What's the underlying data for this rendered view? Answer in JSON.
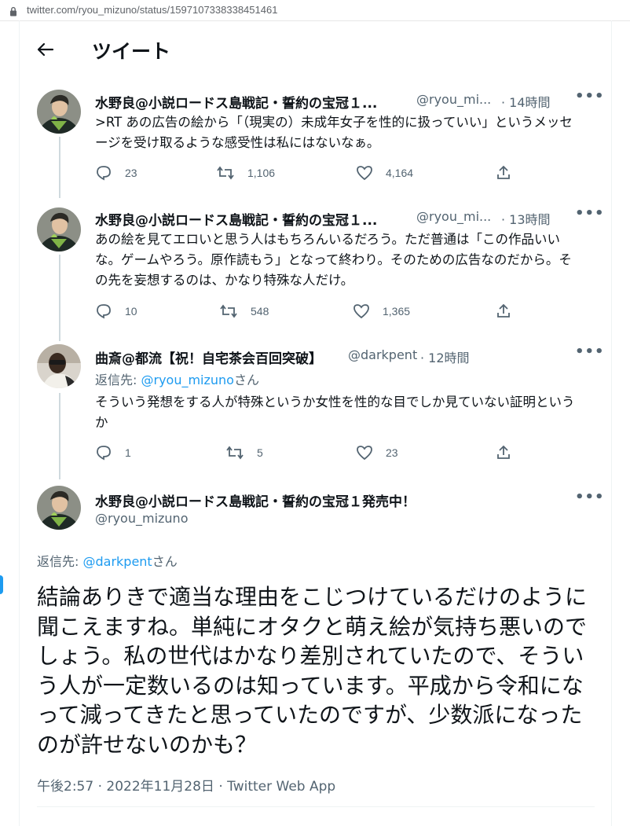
{
  "browser": {
    "url": "twitter.com/ryou_mizuno/status/1597107338338451461"
  },
  "header": {
    "title": "ツイート"
  },
  "thread": [
    {
      "name": "水野良@小説ロードス島戦記・誓約の宝冠１...",
      "handle": "@ryou_mi...",
      "time": "· 14時間",
      "text": ">RT あの広告の絵から「（現実の）未成年女子を性的に扱っていい」というメッセージを受け取るような感受性は私にはないなぁ。",
      "replies": "23",
      "retweets": "1,106",
      "likes": "4,164"
    },
    {
      "name": "水野良@小説ロードス島戦記・誓約の宝冠１...",
      "handle": "@ryou_mi...",
      "time": "· 13時間",
      "text": "あの絵を見てエロいと思う人はもちろんいるだろう。ただ普通は「この作品いいな。ゲームやろう。原作読もう」となって終わり。そのための広告なのだから。その先を妄想するのは、かなり特殊な人だけ。",
      "replies": "10",
      "retweets": "548",
      "likes": "1,365"
    },
    {
      "name": "曲斎@都流【祝！自宅茶会百回突破】",
      "handle": "@darkpent",
      "time": "· 12時間",
      "reply_label": "返信先: ",
      "reply_handle": "@ryou_mizuno",
      "reply_suffix": "さん",
      "text": "そういう発想をする人が特殊というか女性を性的な目でしか見ていない証明というか",
      "replies": "1",
      "retweets": "5",
      "likes": "23"
    }
  ],
  "main": {
    "name": "水野良@小説ロードス島戦記・誓約の宝冠１発売中！",
    "handle": "@ryou_mizuno",
    "reply_label": "返信先: ",
    "reply_handle": "@darkpent",
    "reply_suffix": "さん",
    "text": "結論ありきで適当な理由をこじつけているだけのように聞こえますね。単純にオタクと萌え絵が気持ち悪いのでしょう。私の世代はかなり差別されていたので、そういう人が一定数いるのは知っています。平成から令和になって減ってきたと思っていたのですが、少数派になったのが許せないのかも？",
    "meta": "午後2:57 · 2022年11月28日 · Twitter Web App"
  },
  "icons": [
    "lock-icon",
    "back-arrow-icon",
    "more-icon",
    "reply-icon",
    "retweet-icon",
    "like-icon",
    "share-icon"
  ],
  "colors": {
    "link": "#1d9bf0",
    "secondary": "#536471",
    "text": "#0f1419",
    "thread_line": "#cfd9de"
  }
}
